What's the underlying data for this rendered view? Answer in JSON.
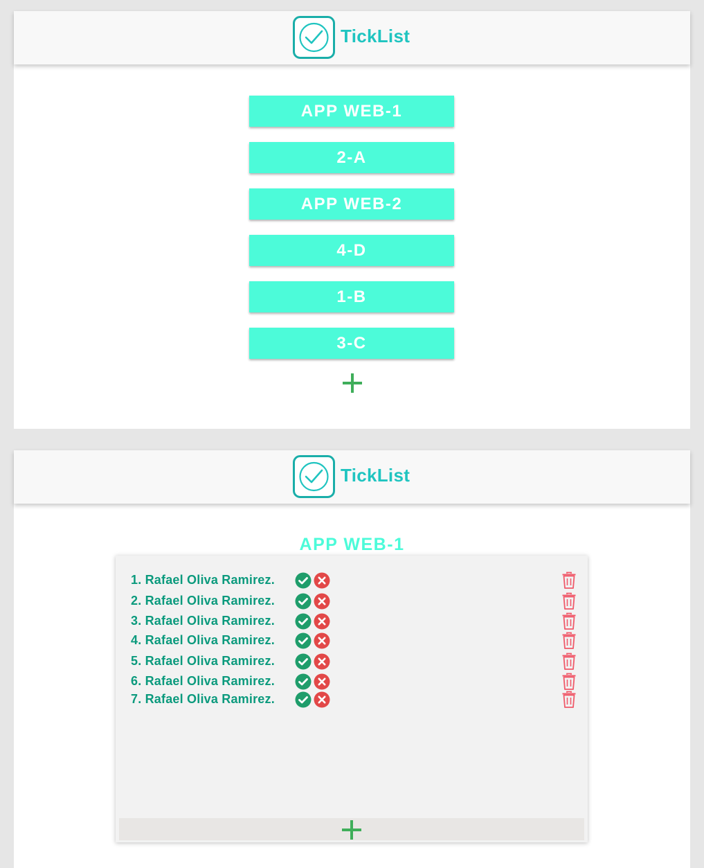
{
  "app": {
    "name": "TickList",
    "accent_color": "#1fc4c0",
    "button_color": "#4cfbd9",
    "add_color": "#3fae5a",
    "delete_color": "#f05a6a"
  },
  "groups_screen": {
    "groups": [
      {
        "label": "APP WEB-1"
      },
      {
        "label": "2-A"
      },
      {
        "label": "APP WEB-2"
      },
      {
        "label": "4-D"
      },
      {
        "label": "1-B"
      },
      {
        "label": "3-C"
      }
    ],
    "add_icon": "plus-icon"
  },
  "attendance_screen": {
    "title": "APP WEB-1",
    "students": [
      {
        "name": "1. Rafael Oliva Ramirez."
      },
      {
        "name": "2. Rafael Oliva Ramirez."
      },
      {
        "name": "3. Rafael Oliva Ramirez."
      },
      {
        "name": "4. Rafael Oliva Ramirez."
      },
      {
        "name": "5. Rafael Oliva Ramirez."
      },
      {
        "name": "6. Rafael Oliva Ramirez."
      },
      {
        "name": "7. Rafael Oliva Ramirez."
      }
    ],
    "icons": {
      "present": "check-circle-icon",
      "absent": "x-circle-icon",
      "delete": "trash-icon",
      "add": "plus-icon"
    }
  }
}
